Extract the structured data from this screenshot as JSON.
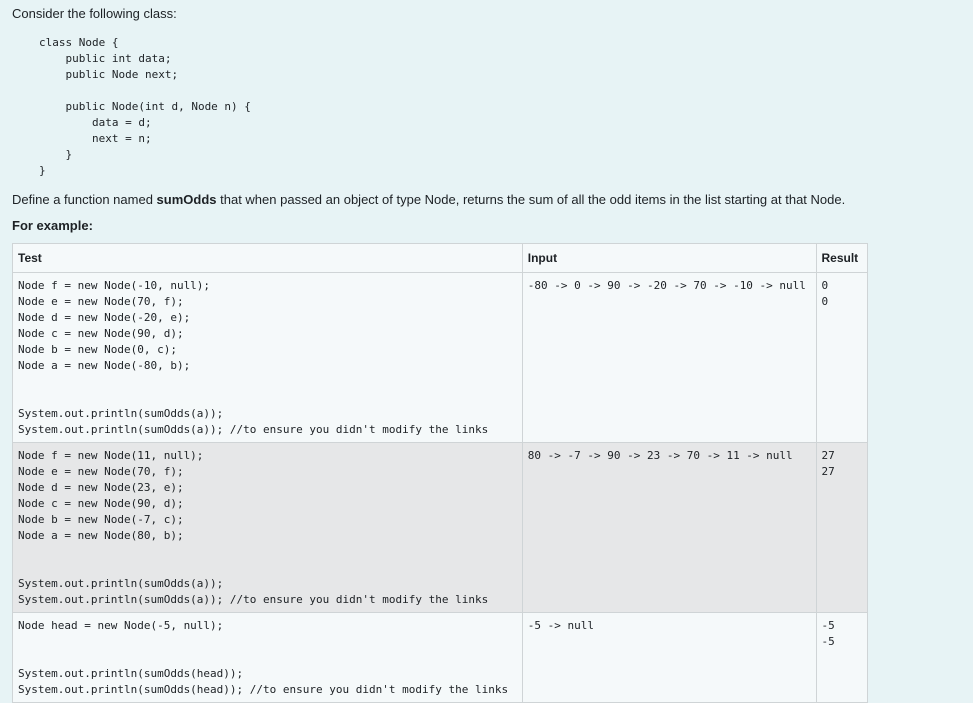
{
  "intro": "Consider the following class:",
  "class_code": "class Node {\n    public int data;\n    public Node next;\n\n    public Node(int d, Node n) {\n        data = d;\n        next = n;\n    }\n}",
  "description": {
    "prefix": "Define a function named ",
    "function_name": "sumOdds",
    "suffix": " that when passed an object of type Node, returns the sum of all the odd items in the list starting at that Node."
  },
  "example_label": "For example:",
  "table": {
    "headers": {
      "test": "Test",
      "input": "Input",
      "result": "Result"
    },
    "rows": [
      {
        "test": "Node f = new Node(-10, null);\nNode e = new Node(70, f);\nNode d = new Node(-20, e);\nNode c = new Node(90, d);\nNode b = new Node(0, c);\nNode a = new Node(-80, b);\n\n\nSystem.out.println(sumOdds(a));\nSystem.out.println(sumOdds(a)); //to ensure you didn't modify the links",
        "input": "-80 -> 0 -> 90 -> -20 -> 70 -> -10 -> null",
        "result": "0\n0"
      },
      {
        "test": "Node f = new Node(11, null);\nNode e = new Node(70, f);\nNode d = new Node(23, e);\nNode c = new Node(90, d);\nNode b = new Node(-7, c);\nNode a = new Node(80, b);\n\n\nSystem.out.println(sumOdds(a));\nSystem.out.println(sumOdds(a)); //to ensure you didn't modify the links",
        "input": "80 -> -7 -> 90 -> 23 -> 70 -> 11 -> null",
        "result": "27\n27"
      },
      {
        "test": "Node head = new Node(-5, null);\n\n\nSystem.out.println(sumOdds(head));\nSystem.out.println(sumOdds(head)); //to ensure you didn't modify the links",
        "input": "-5 -> null",
        "result": "-5\n-5"
      }
    ]
  }
}
